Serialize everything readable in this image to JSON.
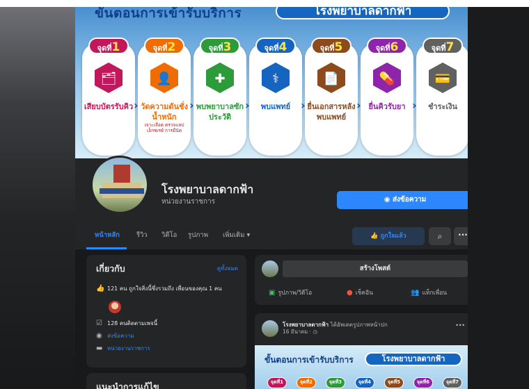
{
  "cover": {
    "title": "ขั้นตอนการเข้ารับบริการ",
    "badge": "โรงพยาบาลดากฟ้า",
    "step_prefix": "จุดที่",
    "steps": [
      {
        "num": "1",
        "label": "เสียบบัตรรับคิว",
        "color": "#c2185b"
      },
      {
        "num": "2",
        "label": "วัดความดันชั่งน้ำหนัก",
        "sub": "เจาะเลือด ตรวจแลป เอ็กซเรย์ การมีนัด",
        "color": "#ef6c00"
      },
      {
        "num": "3",
        "label": "พบพยาบาลซักประวัติ",
        "color": "#2e9b3a"
      },
      {
        "num": "4",
        "label": "พบแพทย์",
        "color": "#1565c0"
      },
      {
        "num": "5",
        "label": "ยื่นเอกสารหลังพบแพทย์",
        "color": "#8d4a1c"
      },
      {
        "num": "6",
        "label": "ยื่นคิวรับยา",
        "color": "#8e24aa"
      },
      {
        "num": "7",
        "label": "ชำระเงิน",
        "color": "#616161"
      }
    ]
  },
  "profile": {
    "name": "โรงพยาบาลดากฟ้า",
    "category": "หน่วยงานราชการ",
    "message_button": "ส่งข้อความ"
  },
  "tabs": {
    "items": [
      "หน้าหลัก",
      "รีวิว",
      "วิดีโอ",
      "รูปภาพ",
      "เพิ่มเติม ▾"
    ],
    "liked_button": "ถูกใจแล้ว",
    "search_glyph": "⌕",
    "more_glyph": "···"
  },
  "about": {
    "title": "เกี่ยวกับ",
    "see_all": "ดูทั้งหมด",
    "likes": "121 คน ถูกใจสิ่งนี้ซึ่งรวมถึง เพื่อนของคุณ 1 คน",
    "followers": "128 คนติดตามเพจนี้",
    "send_message": "ส่งข้อความ",
    "category": "หน่วยงานราชการ"
  },
  "recommend": {
    "title": "แนะนำการแก้ไข"
  },
  "create_post": {
    "label": "สร้างโพสต์",
    "photo_video": "รูปภาพ/วิดีโอ",
    "check_in": "เช็คอิน",
    "tag_friends": "แท็กเพื่อน"
  },
  "post": {
    "author": "โรงพยาบาลดากฟ้า",
    "action": "ได้อัพเดตรูปภาพหน้าปก",
    "date": "16 มีนาคม · ◷",
    "more": "···",
    "image_title": "ขั้นตอนการเข้ารับบริการ",
    "image_badge": "โรงพยาบาลดากฟ้า",
    "mini_steps": [
      "จุดที่1",
      "จุดที่2",
      "จุดที่3",
      "จุดที่4",
      "จุดที่5",
      "จุดที่6",
      "จุดที่7"
    ]
  }
}
